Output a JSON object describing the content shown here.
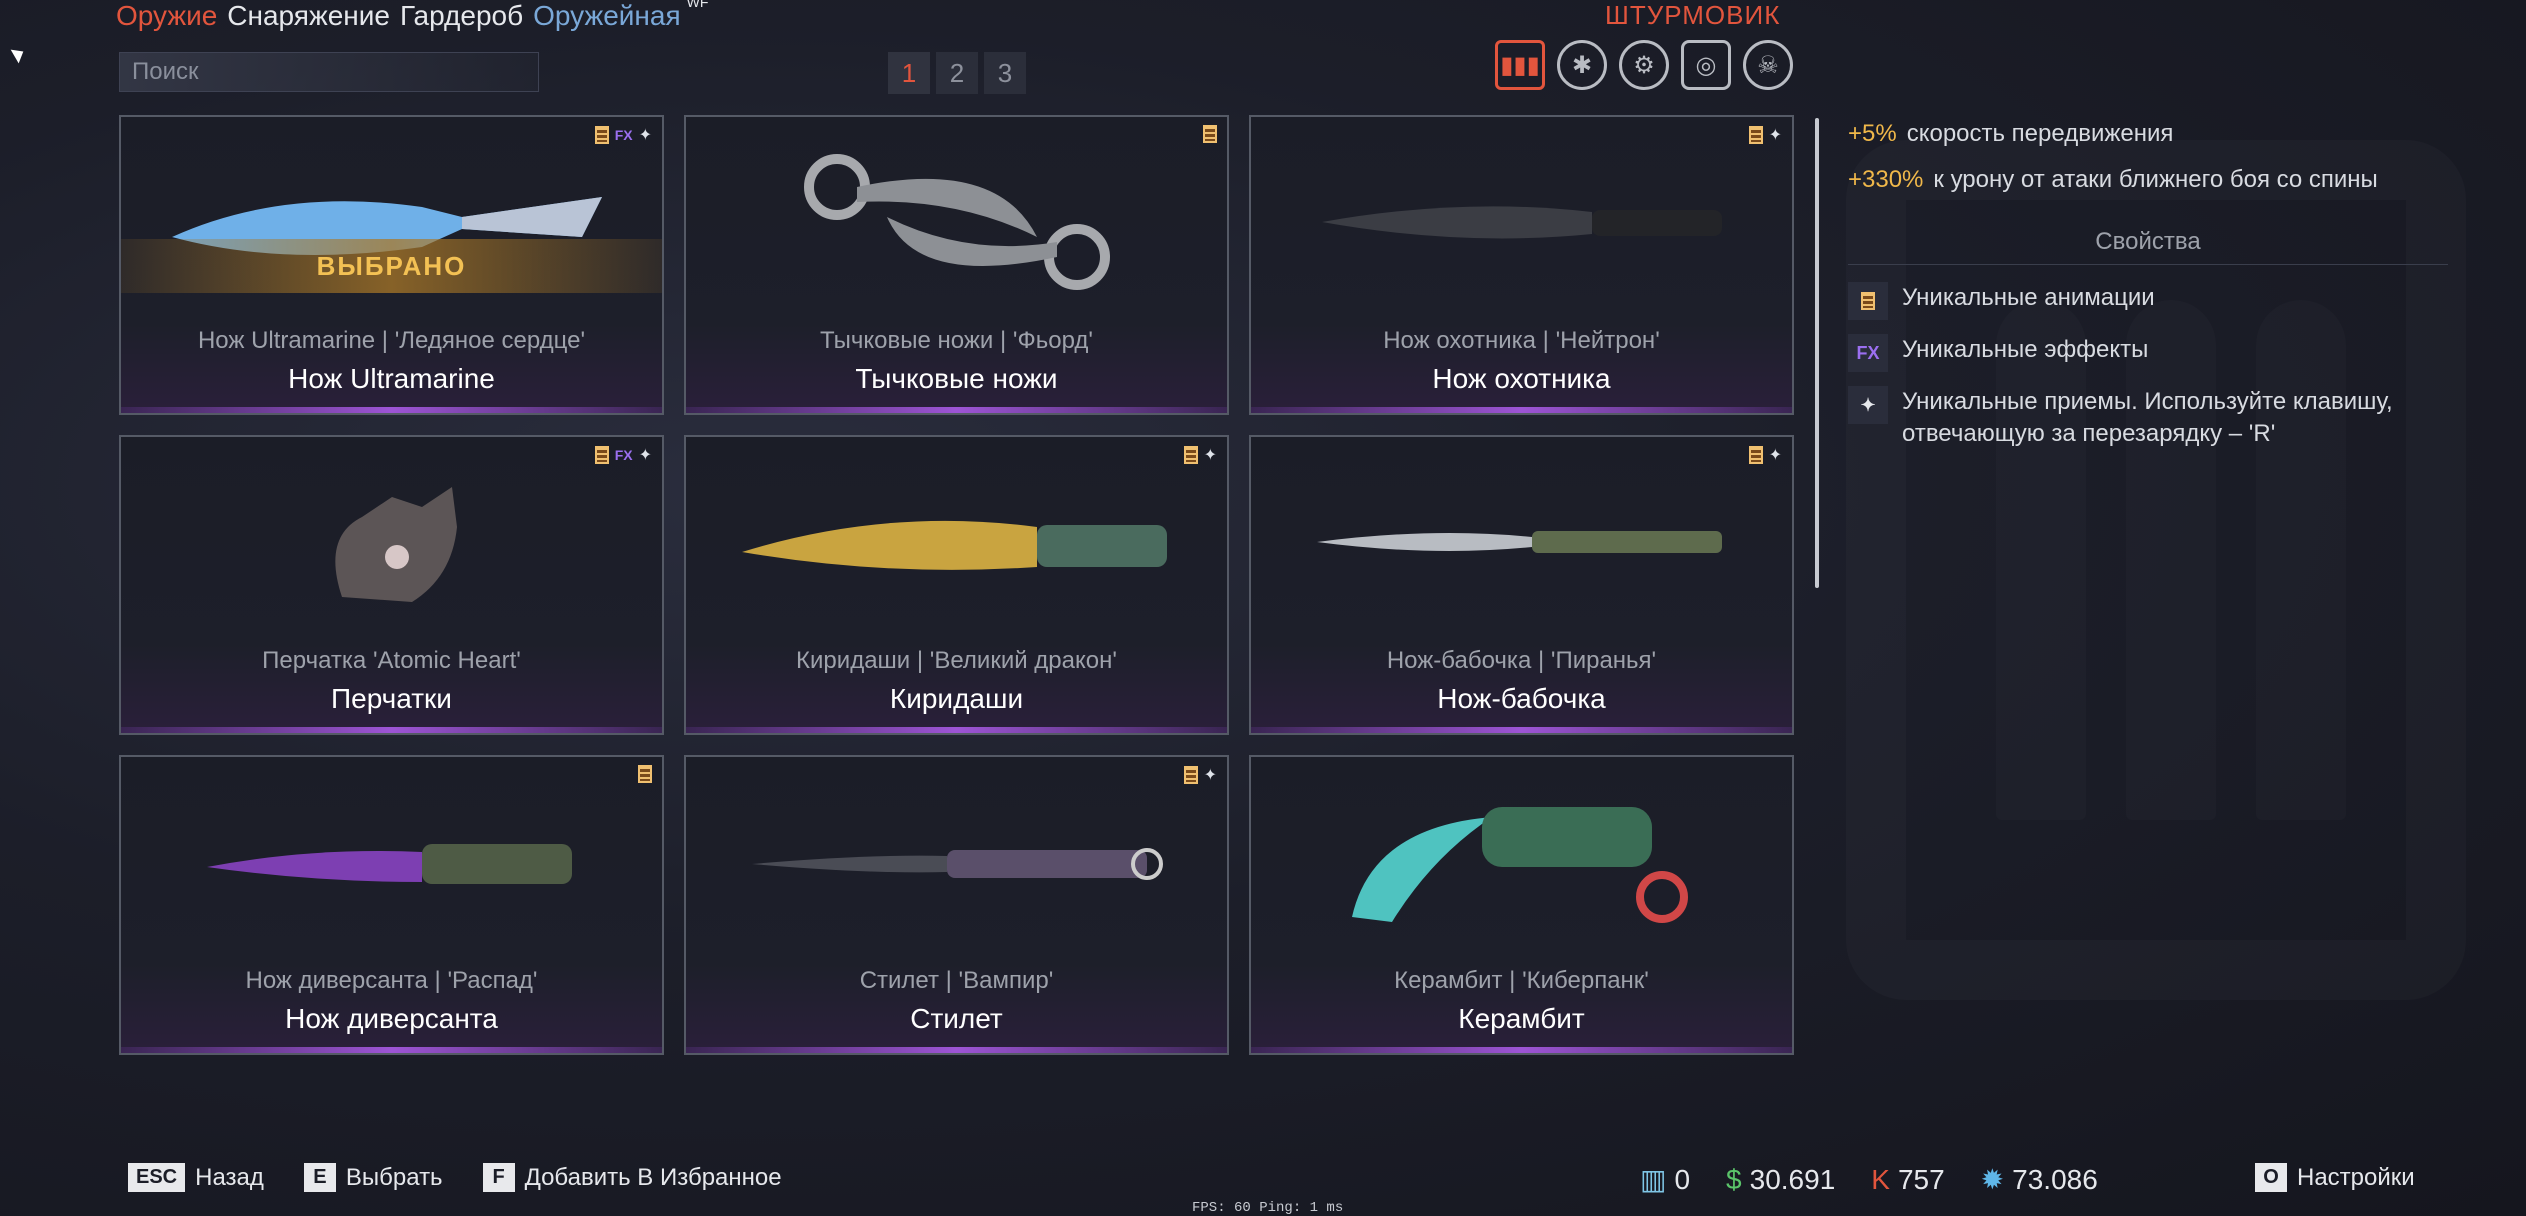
{
  "nav": {
    "tabs": [
      {
        "label": "Оружие",
        "state": "active"
      },
      {
        "label": "Снаряжение",
        "state": "normal"
      },
      {
        "label": "Гардероб",
        "state": "normal"
      },
      {
        "label": "Оружейная",
        "state": "dim"
      }
    ],
    "tag": "WF"
  },
  "search": {
    "placeholder": "Поиск"
  },
  "pager": {
    "pages": [
      "1",
      "2",
      "3"
    ],
    "active": "1"
  },
  "class_title": "ШТУРМОВИК",
  "class_icons": [
    "rifleman-icon",
    "medic-icon",
    "engineer-icon",
    "sniper-icon",
    "skull-icon"
  ],
  "items": [
    {
      "skin": "Нож Ultramarine | 'Ледяное сердце'",
      "name": "Нож Ultramarine",
      "badges": [
        "anim",
        "fx",
        "spark"
      ],
      "selected": true,
      "selected_label": "ВЫБРАНО"
    },
    {
      "skin": "Тычковые ножи | 'Фьорд'",
      "name": "Тычковые ножи",
      "badges": [
        "anim"
      ]
    },
    {
      "skin": "Нож охотника | 'Нейтрон'",
      "name": "Нож охотника",
      "badges": [
        "anim",
        "spark"
      ]
    },
    {
      "skin": "Перчатка 'Atomic Heart'",
      "name": "Перчатки",
      "badges": [
        "anim",
        "fx",
        "spark"
      ]
    },
    {
      "skin": "Киридаши | 'Великий дракон'",
      "name": "Киридаши",
      "badges": [
        "anim",
        "spark"
      ]
    },
    {
      "skin": "Нож-бабочка | 'Пиранья'",
      "name": "Нож-бабочка",
      "badges": [
        "anim",
        "spark"
      ]
    },
    {
      "skin": "Нож диверсанта | 'Распад'",
      "name": "Нож диверсанта",
      "badges": [
        "anim"
      ]
    },
    {
      "skin": "Стилет | 'Вампир'",
      "name": "Стилет",
      "badges": [
        "anim",
        "spark"
      ]
    },
    {
      "skin": "Керамбит | 'Киберпанк'",
      "name": "Керамбит",
      "badges": []
    }
  ],
  "badge_labels": {
    "fx": "FX",
    "spark": "✦"
  },
  "stats": [
    {
      "value": "+5%",
      "text": "скорость передвижения"
    },
    {
      "value": "+330%",
      "text": "к урону от атаки ближнего боя со спины"
    }
  ],
  "props_title": "Свойства",
  "props": [
    {
      "icon": "animation-icon",
      "text": "Уникальные анимации"
    },
    {
      "icon": "fx-icon",
      "icon_label": "FX",
      "text": "Уникальные эффекты"
    },
    {
      "icon": "spark-icon",
      "icon_label": "✦",
      "text": "Уникальные приемы. Используйте клавишу, отвечающую за перезарядку – 'R'"
    }
  ],
  "hotkeys": [
    {
      "key": "ESC",
      "label": "Назад"
    },
    {
      "key": "E",
      "label": "Выбрать"
    },
    {
      "key": "F",
      "label": "Добавить В Избранное"
    }
  ],
  "currencies": [
    {
      "icon": "crown-bank-icon",
      "value": "0",
      "color": "#7fc6e6"
    },
    {
      "icon": "dollar-icon",
      "value": "30.691",
      "color": "#5bc46a"
    },
    {
      "icon": "kredit-icon",
      "value": "757",
      "color": "#e2553d"
    },
    {
      "icon": "gear-currency-icon",
      "value": "73.086",
      "color": "#5fb6e8"
    }
  ],
  "settings": {
    "key": "O",
    "label": "Настройки"
  },
  "perf": "FPS: 60   Ping: 1 ms"
}
